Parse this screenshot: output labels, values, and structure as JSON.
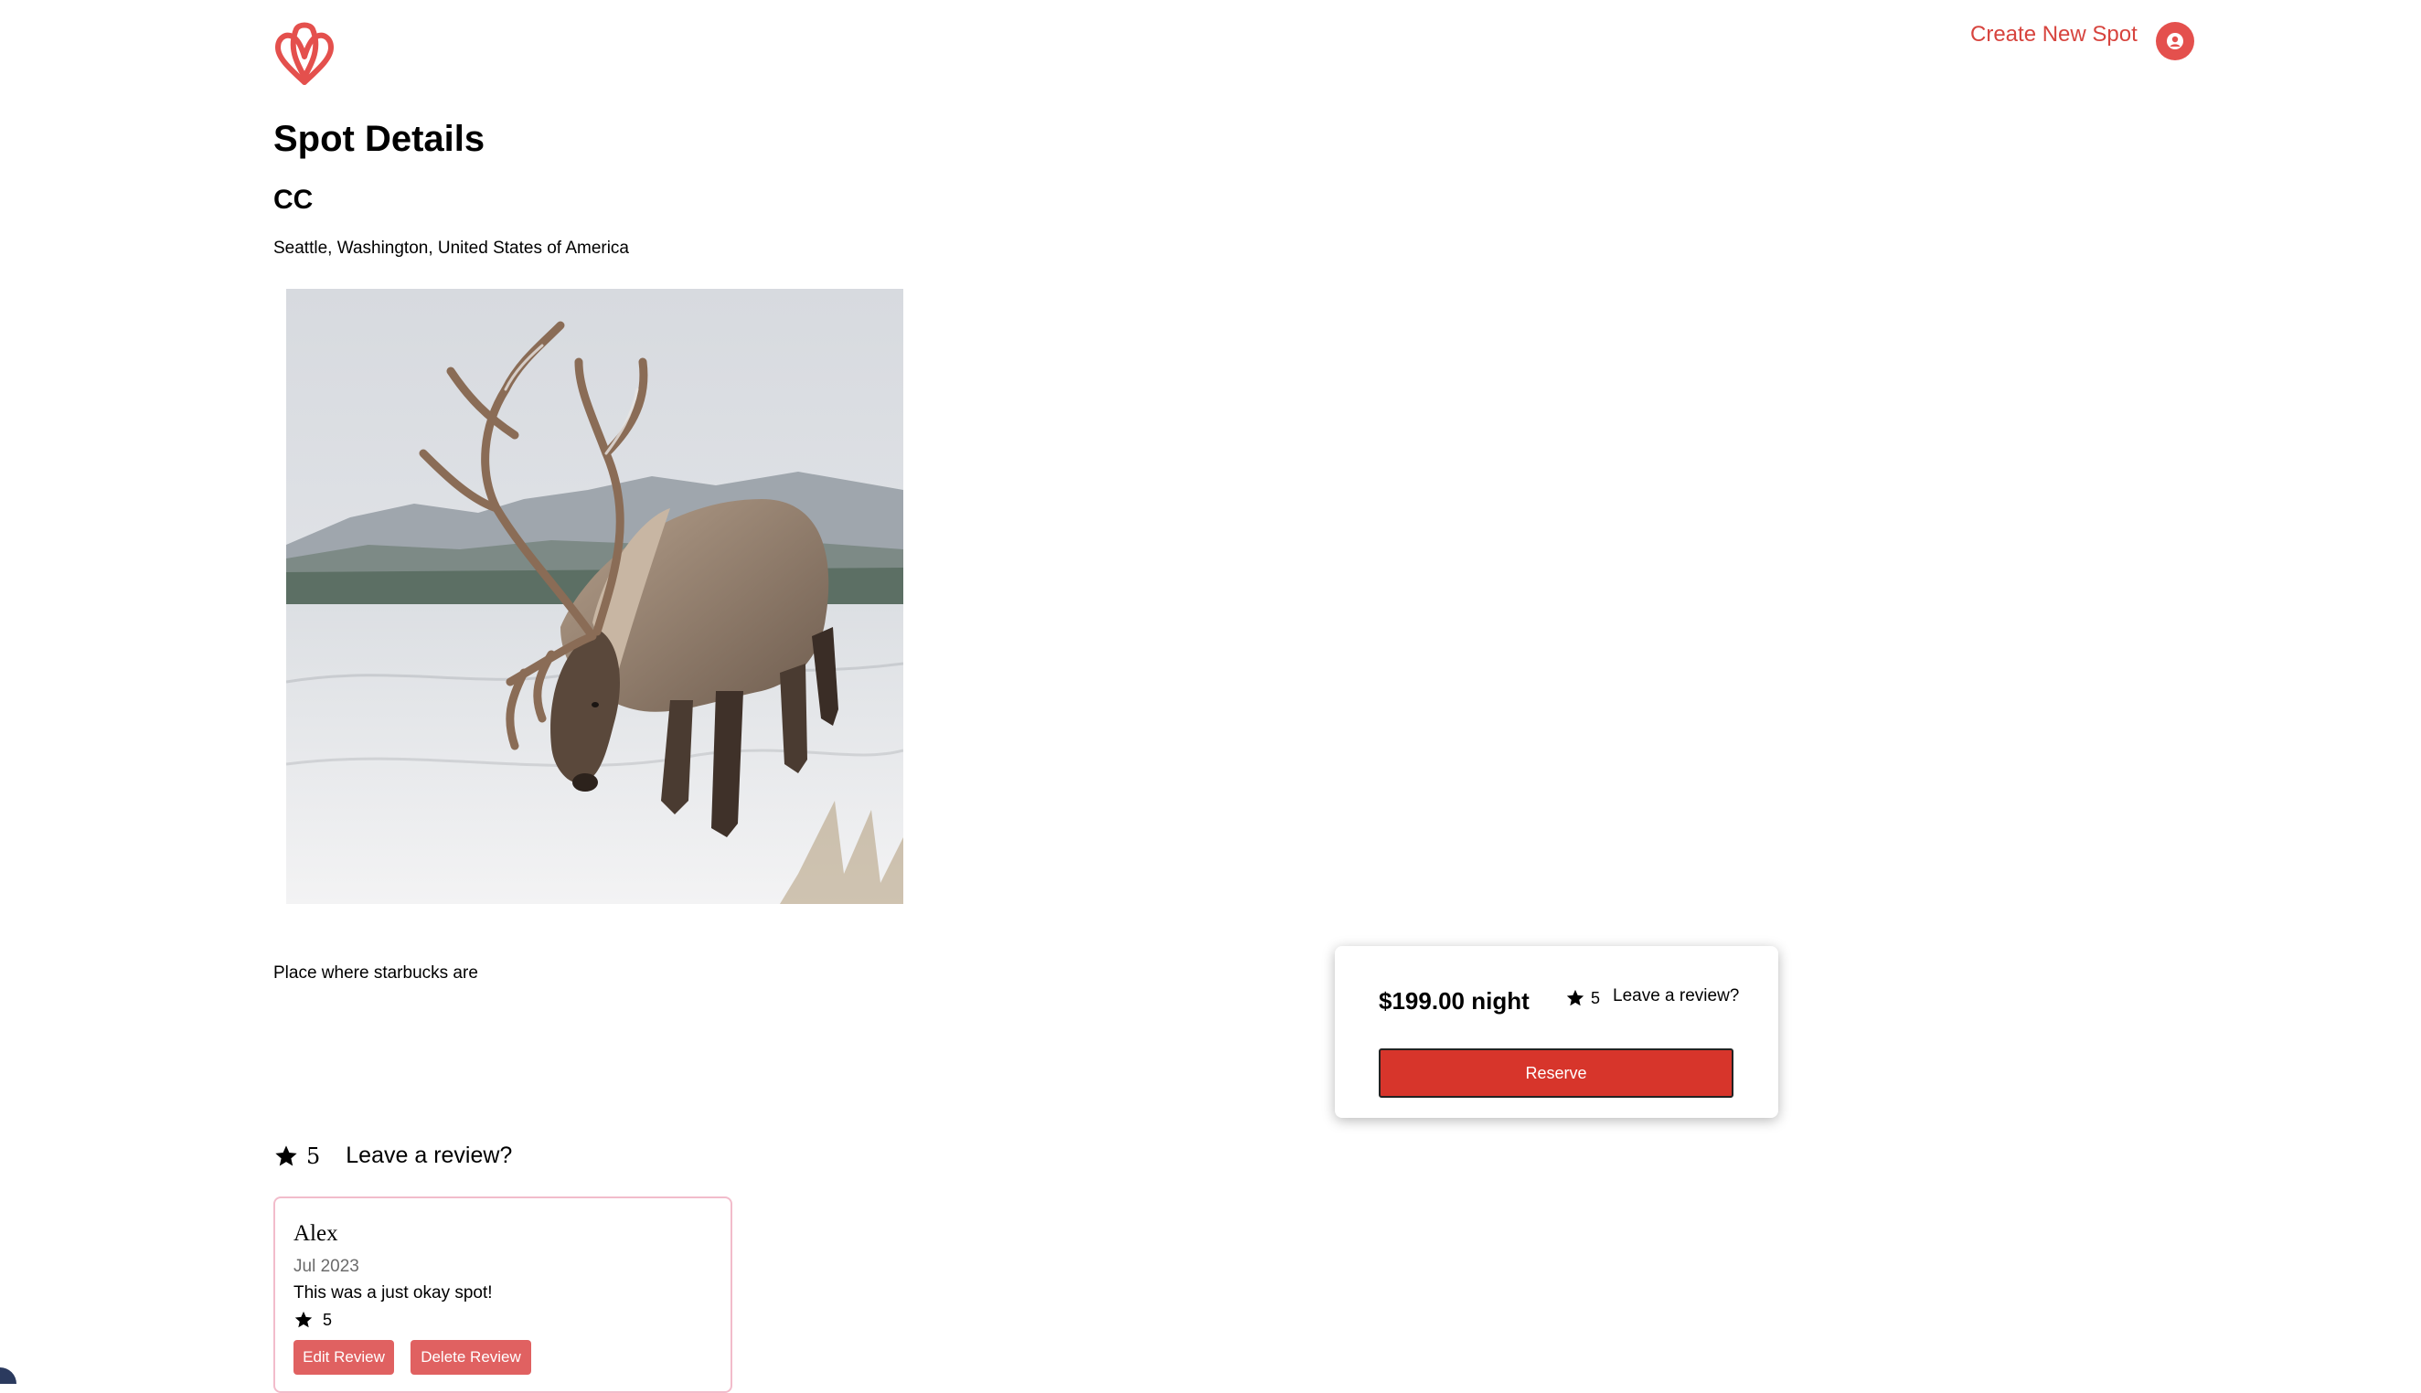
{
  "header": {
    "create_spot_label": "Create New Spot"
  },
  "page": {
    "title": "Spot Details"
  },
  "spot": {
    "name": "CC",
    "location": "Seattle, Washington, United States of America",
    "image_alt": "reindeer grazing in snowy field",
    "description": "Place where starbucks are"
  },
  "booking": {
    "price": "$199.00 night",
    "rating": "5",
    "leave_review": "Leave a review?",
    "reserve_label": "Reserve"
  },
  "reviews": {
    "rating": "5",
    "leave_review": "Leave a review?",
    "items": [
      {
        "author": "Alex",
        "date": "Jul 2023",
        "text": "This was a just okay spot!",
        "rating": "5",
        "edit_label": "Edit Review",
        "delete_label": "Delete Review"
      }
    ]
  },
  "colors": {
    "brand": "#e4504d",
    "reserve": "#d7352b",
    "review_button": "#e06161",
    "review_border": "#f2bccb"
  },
  "icons": {
    "logo": "airbnb-logo-icon",
    "user": "user-circle-icon",
    "star": "star-icon"
  }
}
